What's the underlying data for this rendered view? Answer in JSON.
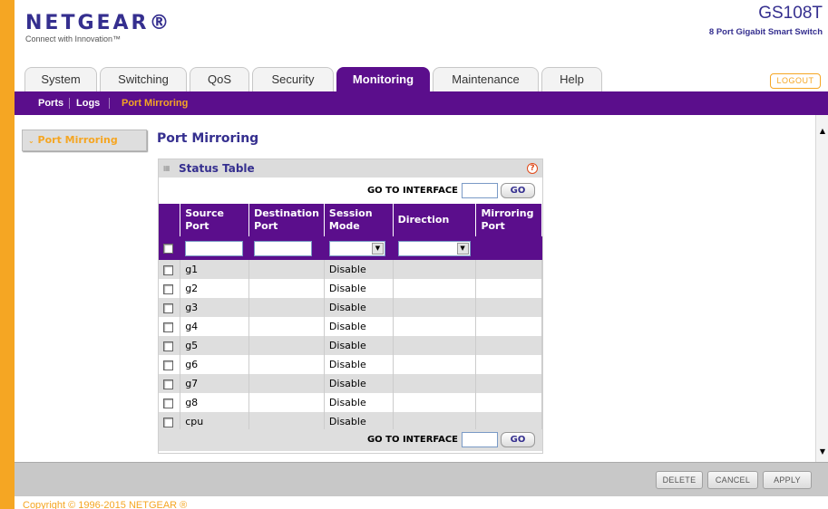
{
  "header": {
    "logo": "NETGEAR®",
    "tagline": "Connect with Innovation™",
    "model": "GS108T",
    "model_desc": "8 Port Gigabit Smart Switch"
  },
  "tabs": [
    {
      "label": "System",
      "active": false
    },
    {
      "label": "Switching",
      "active": false
    },
    {
      "label": "QoS",
      "active": false
    },
    {
      "label": "Security",
      "active": false
    },
    {
      "label": "Monitoring",
      "active": true
    },
    {
      "label": "Maintenance",
      "active": false
    },
    {
      "label": "Help",
      "active": false
    }
  ],
  "logout_label": "LOGOUT",
  "subnav": [
    {
      "label": "Ports",
      "active": false
    },
    {
      "label": "Logs",
      "active": false
    },
    {
      "label": "Port Mirroring",
      "active": true
    }
  ],
  "sidebar": {
    "item": "Port Mirroring"
  },
  "page_title": "Port Mirroring",
  "panel": {
    "title": "Status Table",
    "help": "?",
    "goto_label": "GO TO INTERFACE",
    "go_label": "GO",
    "columns": [
      "Source Port",
      "Destination Port",
      "Session Mode",
      "Direction",
      "Mirroring Port"
    ],
    "rows": [
      {
        "port": "g1",
        "mode": "Disable"
      },
      {
        "port": "g2",
        "mode": "Disable"
      },
      {
        "port": "g3",
        "mode": "Disable"
      },
      {
        "port": "g4",
        "mode": "Disable"
      },
      {
        "port": "g5",
        "mode": "Disable"
      },
      {
        "port": "g6",
        "mode": "Disable"
      },
      {
        "port": "g7",
        "mode": "Disable"
      },
      {
        "port": "g8",
        "mode": "Disable"
      },
      {
        "port": "cpu",
        "mode": "Disable"
      }
    ]
  },
  "footer": {
    "delete": "DELETE",
    "cancel": "CANCEL",
    "apply": "APPLY"
  },
  "copyright": "Copyright © 1996-2015 NETGEAR ®",
  "colors": {
    "brand_purple": "#5b0e8c",
    "brand_orange": "#f5a623",
    "logo_blue": "#352f8f"
  }
}
